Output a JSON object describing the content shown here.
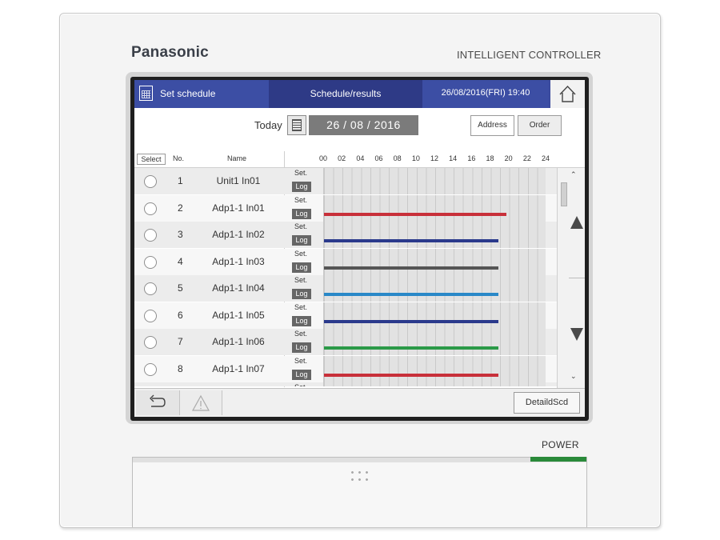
{
  "device": {
    "brand": "Panasonic",
    "product": "INTELLIGENT CONTROLLER",
    "power_label": "POWER"
  },
  "header": {
    "title": "Set schedule",
    "tab": "Schedule/results",
    "datetime": "26/08/2016(FRI) 19:40",
    "home_icon": "home-icon",
    "calendar_icon": "calendar-icon"
  },
  "toolbar": {
    "today_label": "Today",
    "date": "26 / 08 / 2016",
    "address_label": "Address",
    "order_label": "Order"
  },
  "columns": {
    "select": "Select",
    "no": "No.",
    "name": "Name",
    "hours": [
      "00",
      "02",
      "04",
      "06",
      "08",
      "10",
      "12",
      "14",
      "16",
      "18",
      "20",
      "22",
      "24"
    ]
  },
  "rows": [
    {
      "no": "1",
      "name": "Unit1 In01",
      "set": "Set.",
      "log": "Log",
      "log_bar": null
    },
    {
      "no": "2",
      "name": "Adp1-1 In01",
      "set": "Set.",
      "log": "Log",
      "log_bar": {
        "start": 0,
        "end": 19.67,
        "color": "#c8303a"
      }
    },
    {
      "no": "3",
      "name": "Adp1-1 In02",
      "set": "Set.",
      "log": "Log",
      "log_bar": {
        "start": 0,
        "end": 18.83,
        "color": "#2b3a8c"
      }
    },
    {
      "no": "4",
      "name": "Adp1-1 In03",
      "set": "Set.",
      "log": "Log",
      "log_bar": {
        "start": 0,
        "end": 18.83,
        "color": "#555555"
      }
    },
    {
      "no": "5",
      "name": "Adp1-1 In04",
      "set": "Set.",
      "log": "Log",
      "log_bar": {
        "start": 0,
        "end": 18.83,
        "color": "#2a88c8"
      }
    },
    {
      "no": "6",
      "name": "Adp1-1 In05",
      "set": "Set.",
      "log": "Log",
      "log_bar": {
        "start": 0,
        "end": 18.83,
        "color": "#2b3a8c"
      }
    },
    {
      "no": "7",
      "name": "Adp1-1 In06",
      "set": "Set.",
      "log": "Log",
      "log_bar": {
        "start": 0,
        "end": 18.83,
        "color": "#2b9a48"
      }
    },
    {
      "no": "8",
      "name": "Adp1-1 In07",
      "set": "Set.",
      "log": "Log",
      "log_bar": {
        "start": 0,
        "end": 18.83,
        "color": "#c8303a"
      }
    },
    {
      "no": "",
      "name": "",
      "set": "Set.",
      "log": "",
      "log_bar": null
    }
  ],
  "footer": {
    "back_icon": "back-arrow-icon",
    "warning_icon": "warning-icon",
    "detail_label": "DetaildScd"
  }
}
